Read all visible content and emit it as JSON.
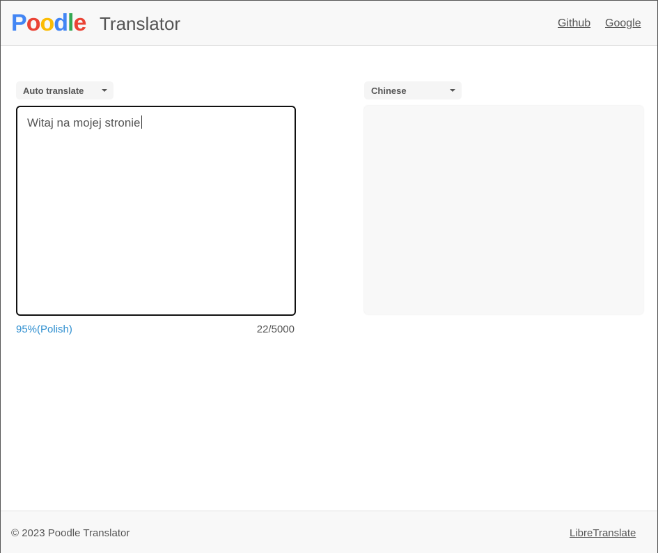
{
  "header": {
    "logo": {
      "letters": [
        "P",
        "o",
        "o",
        "d",
        "l",
        "e"
      ],
      "colors": [
        "#4285F4",
        "#EA4335",
        "#FBBC05",
        "#4285F4",
        "#34A853",
        "#EA4335"
      ]
    },
    "app_name": "Translator",
    "links": [
      "Github",
      "Google"
    ]
  },
  "source": {
    "language": "Auto translate",
    "text": "Witaj na mojej stronie",
    "detected": "95%(Polish)",
    "char_count": "22/5000"
  },
  "target": {
    "language": "Chinese",
    "text": ""
  },
  "footer": {
    "copyright": "© 2023 Poodle Translator",
    "link": "LibreTranslate"
  },
  "colors": {
    "link_blue": "#2f8fd0",
    "header_bg": "#f8f8f8"
  }
}
